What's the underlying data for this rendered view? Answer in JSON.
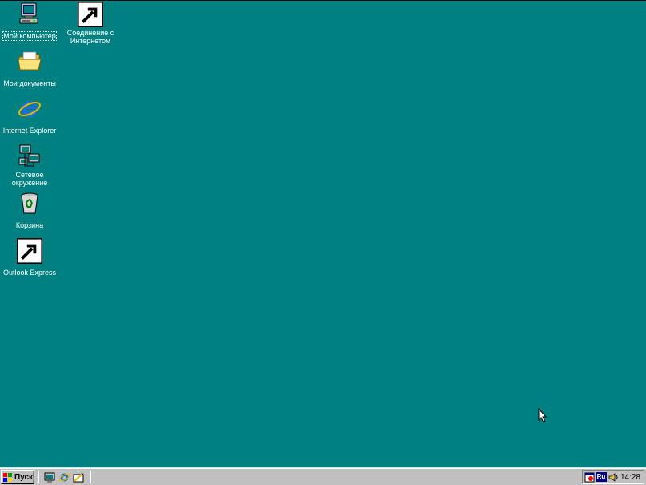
{
  "desktop": {
    "background": "#008080",
    "icons": [
      {
        "label": "Мой компьютер",
        "icon": "my-computer-icon",
        "selected": true
      },
      {
        "label": "Соединение с Интернетом",
        "icon": "internet-connection-icon",
        "shortcut": true
      },
      {
        "label": "Мои документы",
        "icon": "my-documents-icon"
      },
      {
        "label": "Internet Explorer",
        "icon": "internet-explorer-icon"
      },
      {
        "label": "Сетевое окружение",
        "icon": "network-neighborhood-icon"
      },
      {
        "label": "Корзина",
        "icon": "recycle-bin-icon"
      },
      {
        "label": "Outlook Express",
        "icon": "outlook-express-icon",
        "shortcut": true
      }
    ]
  },
  "taskbar": {
    "start_label": "Пуск",
    "quick_launch": [
      "show-desktop-icon",
      "internet-explorer-icon",
      "outlook-express-icon"
    ],
    "tray": {
      "icons": [
        "scheduler-icon",
        "volume-icon"
      ],
      "language": "Ru",
      "clock": "14:28"
    }
  }
}
